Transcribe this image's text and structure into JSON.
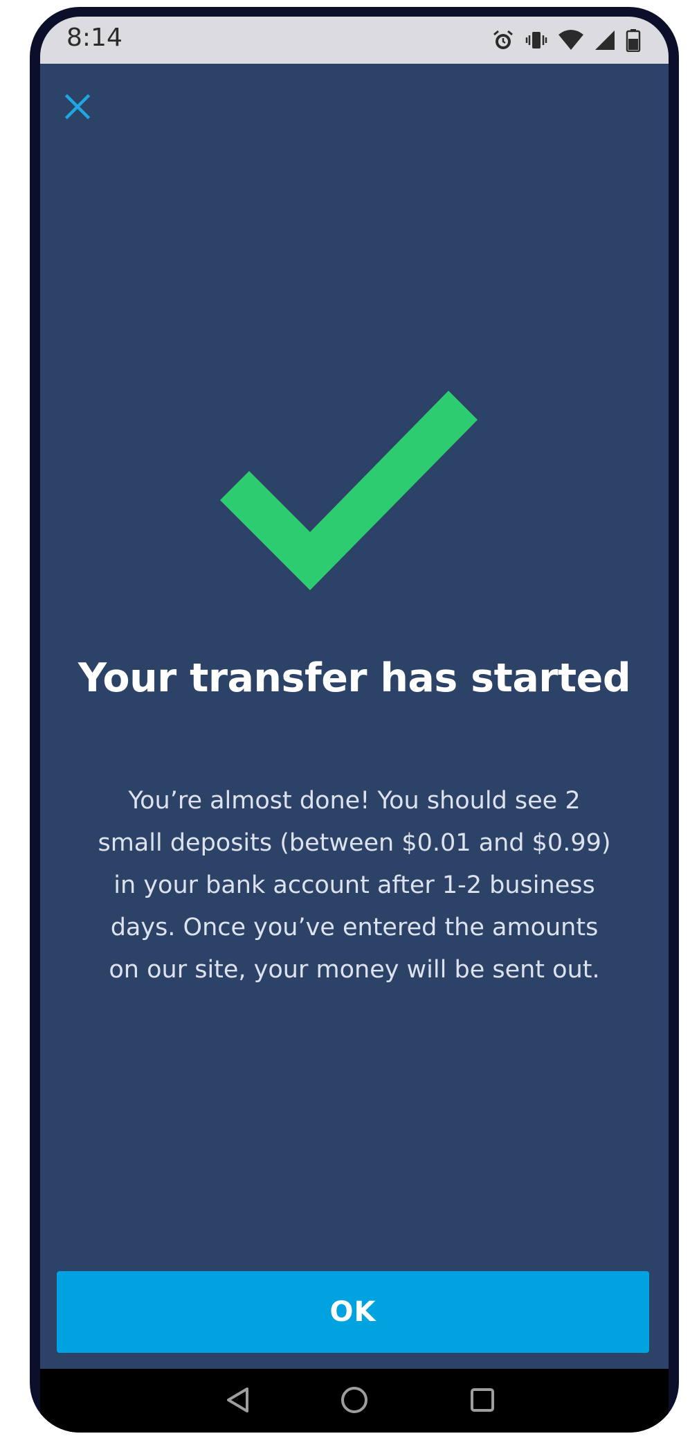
{
  "status_bar": {
    "time": "8:14",
    "icons": [
      "alarm-icon",
      "vibrate-icon",
      "wifi-icon",
      "signal-icon",
      "battery-icon"
    ]
  },
  "header": {
    "close_icon": "close-icon"
  },
  "main": {
    "success_icon": "checkmark-icon",
    "title": "Your transfer has started",
    "body_lines": [
      "You’re almost done! You should see 2",
      "small deposits (between $0.01 and $0.99)",
      "in your bank account after 1-2 business",
      "days. Once you’ve entered the amounts",
      "on our site, your money will be sent out."
    ]
  },
  "footer": {
    "ok_label": "OK"
  },
  "nav_bar": {
    "icons": [
      "back-icon",
      "home-icon",
      "recents-icon"
    ]
  },
  "colors": {
    "background": "#2d4267",
    "accent": "#00a3df",
    "success": "#2ecc71",
    "close_icon": "#1ea7e1"
  }
}
